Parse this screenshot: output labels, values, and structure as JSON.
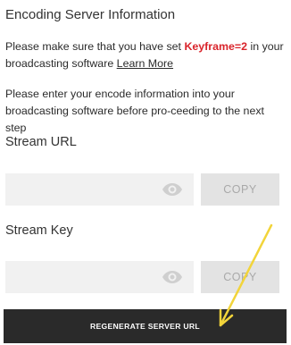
{
  "panel": {
    "title": "Encoding Server Information",
    "keyframe_intro": "Please make sure that you have set ",
    "keyframe_value": "Keyframe=2",
    "keyframe_outro": " in your broadcasting software ",
    "learn_more": "Learn More",
    "instructions": "Please enter your encode information into your broadcasting software before pro-ceeding to the next step"
  },
  "stream_url": {
    "label": "Stream URL",
    "value": "",
    "copy_label": "COPY"
  },
  "stream_key": {
    "label": "Stream Key",
    "value": "",
    "copy_label": "COPY"
  },
  "regenerate_label": "REGENERATE SERVER URL",
  "colors": {
    "keyframe": "#d9242b",
    "regenerate_bg": "#2a2a2a",
    "field_bg": "#f1f1f1",
    "copy_bg": "#e3e3e3",
    "annotation_arrow": "#f2d43a"
  },
  "icons": {
    "url_visibility": "eye-icon",
    "key_visibility": "eye-icon"
  }
}
